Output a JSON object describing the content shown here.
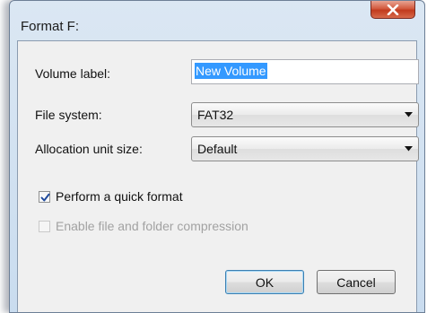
{
  "window": {
    "title": "Format F:"
  },
  "form": {
    "volume_label": {
      "label": "Volume label:",
      "value": "New Volume"
    },
    "file_system": {
      "label": "File system:",
      "selected": "FAT32"
    },
    "allocation_unit_size": {
      "label": "Allocation unit size:",
      "selected": "Default"
    },
    "quick_format": {
      "label": "Perform a quick format",
      "checked": true
    },
    "compression": {
      "label": "Enable file and folder compression",
      "checked": false,
      "enabled": false
    }
  },
  "buttons": {
    "ok": "OK",
    "cancel": "Cancel"
  },
  "icons": {
    "close": "close-icon",
    "dropdown": "chevron-down-icon",
    "check": "checkmark-icon"
  },
  "colors": {
    "selection": "#3399ff",
    "close_button": "#c13a1d",
    "checkmark": "#1f4a9c"
  }
}
